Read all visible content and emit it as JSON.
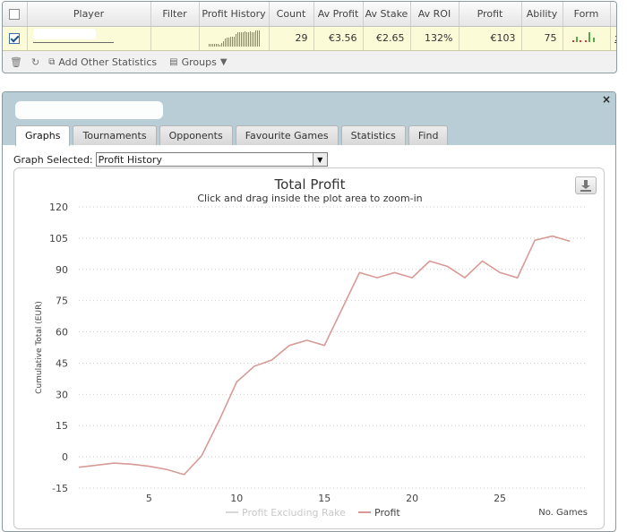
{
  "stats_table": {
    "columns": [
      "Player",
      "Filter",
      "Profit History",
      "Count",
      "Av Profit",
      "Av Stake",
      "Av ROI",
      "Profit",
      "Ability",
      "Form"
    ],
    "row": {
      "count": "29",
      "av_profit": "€3.56",
      "av_stake": "€2.65",
      "av_roi": "132%",
      "profit": "€103",
      "ability": "75",
      "remove": "x"
    },
    "toolbar": {
      "add_other_statistics": "Add Other Statistics",
      "groups": "Groups"
    }
  },
  "panel": {
    "tabs": [
      "Graphs",
      "Tournaments",
      "Opponents",
      "Favourite Games",
      "Statistics",
      "Find"
    ],
    "active_tab": "Graphs",
    "graph_selected_label": "Graph Selected:",
    "graph_selected_value": "Profit History",
    "close": "×"
  },
  "colors": {
    "profit_line": "#d89a96",
    "excl_rake_line": "#d8d8d8",
    "header_bg": "#b8cdd6",
    "row_bg": "#fbfbd8"
  },
  "chart_data": {
    "type": "line",
    "title": "Total Profit",
    "subtitle": "Click and drag inside the plot area to zoom-in",
    "xlabel": "No. Games",
    "ylabel": "Cumulative Total (EUR)",
    "xlim": [
      1,
      30
    ],
    "ylim": [
      -15,
      120
    ],
    "x_ticks": [
      "5",
      "10",
      "15",
      "20",
      "25"
    ],
    "y_ticks": [
      "120",
      "105",
      "90",
      "75",
      "60",
      "45",
      "30",
      "15",
      "0",
      "-15"
    ],
    "grid": true,
    "legend_position": "bottom-center",
    "series": [
      {
        "name": "Profit Excluding Rake",
        "values": []
      },
      {
        "name": "Profit",
        "x": [
          1,
          2,
          3,
          4,
          5,
          6,
          7,
          8,
          9,
          10,
          11,
          12,
          13,
          14,
          15,
          16,
          17,
          18,
          19,
          20,
          21,
          22,
          23,
          24,
          25,
          26,
          27,
          28,
          29
        ],
        "values": [
          -5,
          -4,
          -3,
          -3.5,
          -4.5,
          -6,
          -8.5,
          0.5,
          17.5,
          36,
          43.5,
          46.5,
          53.5,
          56,
          53.5,
          71,
          88.5,
          86,
          88.5,
          86,
          94,
          91.5,
          86,
          94,
          88.5,
          86,
          104,
          106,
          103.5
        ]
      }
    ]
  }
}
